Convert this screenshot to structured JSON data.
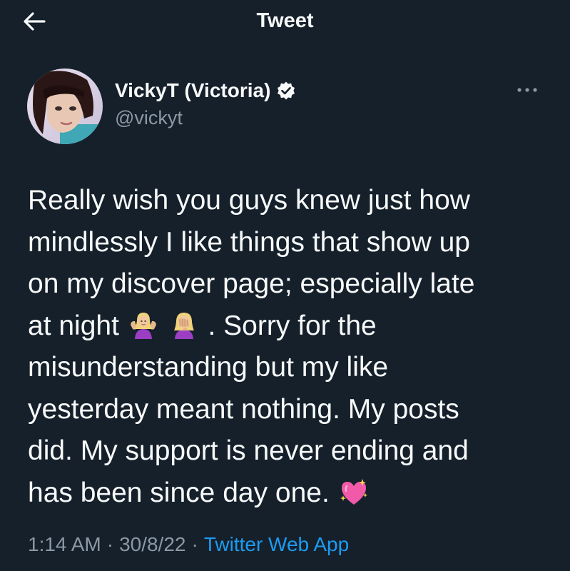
{
  "header": {
    "title": "Tweet",
    "back_icon": "arrow-left-icon"
  },
  "author": {
    "display_name": "VickyT (Victoria)",
    "handle": "@vickyt",
    "verified_icon": "verified-badge-icon",
    "avatar_icon": "avatar"
  },
  "more_icon": "more-horizontal-icon",
  "tweet": {
    "lines": [
      "Really wish you guys knew just how",
      "mindlessly I like things that show up",
      "on my discover page; especially late",
      "at night",
      ". Sorry for the",
      "misunderstanding but my like",
      "yesterday meant nothing. My posts",
      "did. My support is never ending and",
      "has been since day one."
    ],
    "emojis": [
      "shrugging-woman-emoji",
      "facepalm-woman-emoji",
      "sparkling-heart-emoji"
    ]
  },
  "meta": {
    "time": "1:14 AM",
    "date": "30/8/22",
    "source": "Twitter Web App",
    "separator": "·"
  },
  "colors": {
    "background": "#15202b",
    "text": "#f7f9f9",
    "secondary_text": "#8b98a5",
    "accent": "#1d9bf0"
  }
}
